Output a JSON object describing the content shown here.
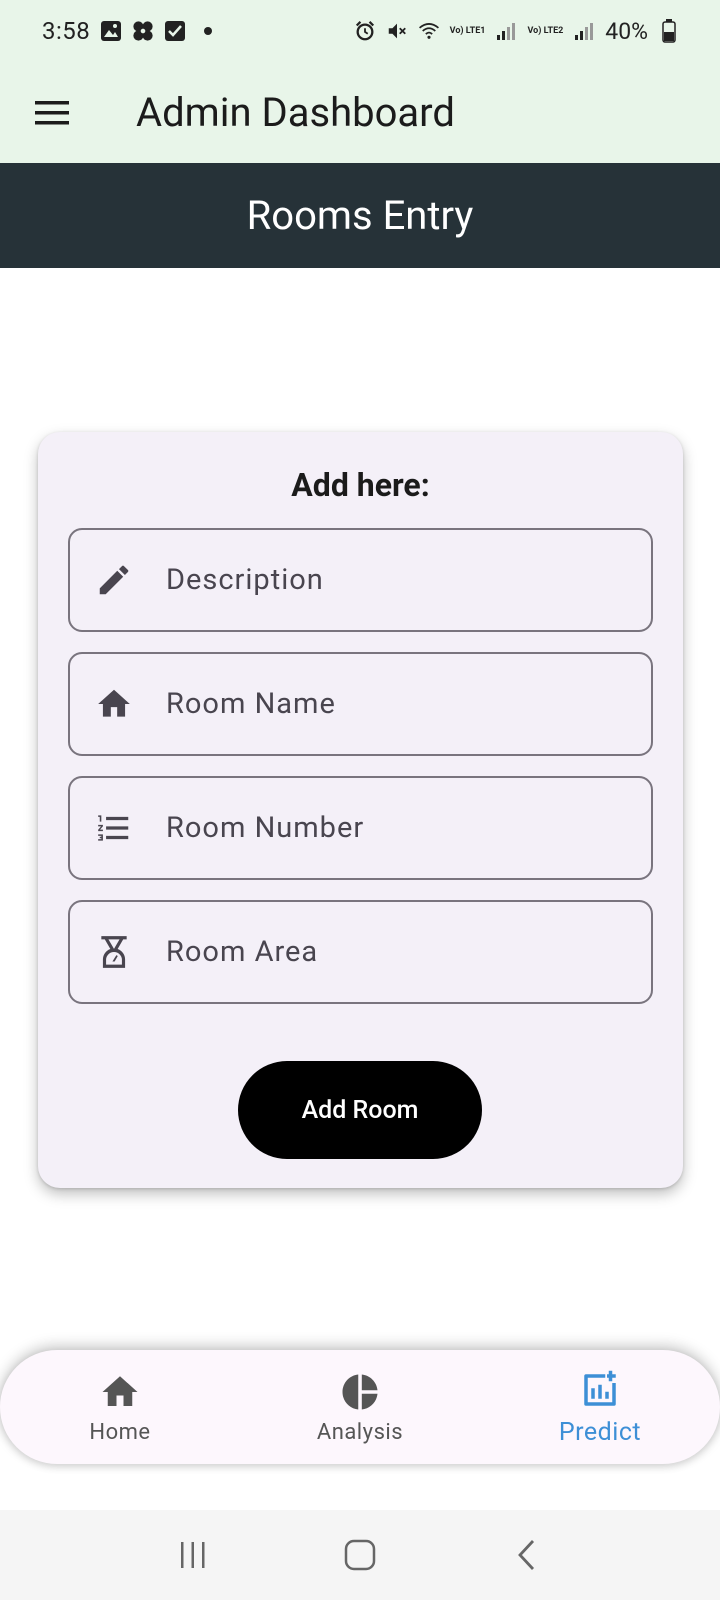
{
  "status_bar": {
    "time": "3:58",
    "battery": "40%",
    "lte1": "Vo) LTE1",
    "lte2": "Vo) LTE2",
    "left_icons": [
      "gallery-icon",
      "fan-icon",
      "checkbox-icon",
      "notification-dot"
    ],
    "right_icons": [
      "alarm-icon",
      "mute-icon",
      "wifi-icon",
      "signal-icon",
      "battery-icon"
    ]
  },
  "app_bar": {
    "title": "Admin Dashboard",
    "menu_icon": "hamburger-icon"
  },
  "header": {
    "title": "Rooms Entry"
  },
  "card": {
    "title": "Add here:",
    "fields": [
      {
        "placeholder": "Description",
        "icon": "pencil-icon"
      },
      {
        "placeholder": "Room Name",
        "icon": "home-icon"
      },
      {
        "placeholder": "Room Number",
        "icon": "numbered-list-icon"
      },
      {
        "placeholder": "Room Area",
        "icon": "scale-icon"
      }
    ],
    "submit_label": "Add Room"
  },
  "bottom_nav": {
    "items": [
      {
        "label": "Home",
        "icon": "home-icon",
        "active": false
      },
      {
        "label": "Analysis",
        "icon": "pie-chart-icon",
        "active": false
      },
      {
        "label": "Predict",
        "icon": "insights-icon",
        "active": true
      }
    ]
  },
  "colors": {
    "app_bar_bg": "#e8f5e9",
    "header_bg": "#263238",
    "card_bg": "#f4f0f8",
    "button_bg": "#000000",
    "active_nav": "#3d8fd6"
  }
}
